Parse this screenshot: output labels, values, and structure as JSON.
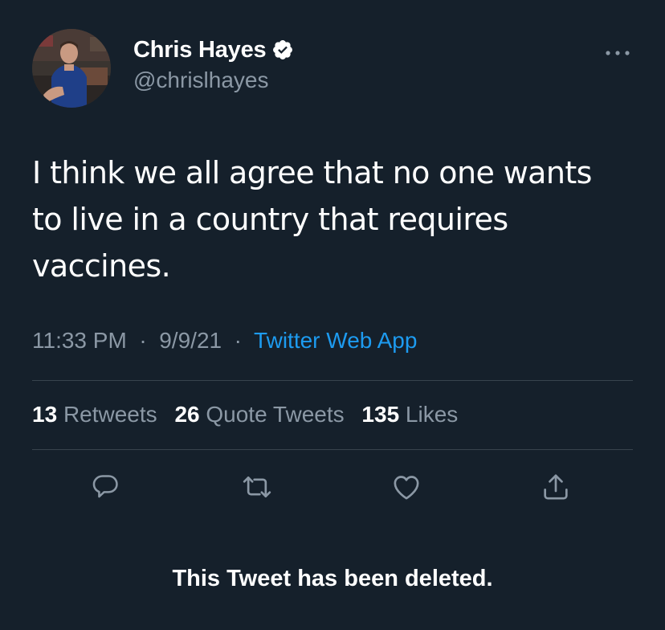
{
  "author": {
    "display_name": "Chris Hayes",
    "handle": "@chrislhayes",
    "verified": true,
    "avatar_icon": "avatar-photo"
  },
  "tweet": {
    "text_lines": [
      "I think we all agree that no one wants",
      "to live in a country that requires",
      "vaccines."
    ],
    "time": "11:33 PM",
    "date": "9/9/21",
    "separator": "·",
    "source": "Twitter Web App"
  },
  "stats": {
    "retweets_count": "13",
    "retweets_label": "Retweets",
    "quotes_count": "26",
    "quotes_label": "Quote Tweets",
    "likes_count": "135",
    "likes_label": "Likes"
  },
  "actions": [
    "reply-icon",
    "retweet-icon",
    "like-icon",
    "share-icon"
  ],
  "notice": "This Tweet has been deleted.",
  "colors": {
    "background": "#15202b",
    "secondary_text": "#8b98a5",
    "link": "#1d9bf0",
    "divider": "#38444d",
    "verified_badge": "#ffffff"
  }
}
